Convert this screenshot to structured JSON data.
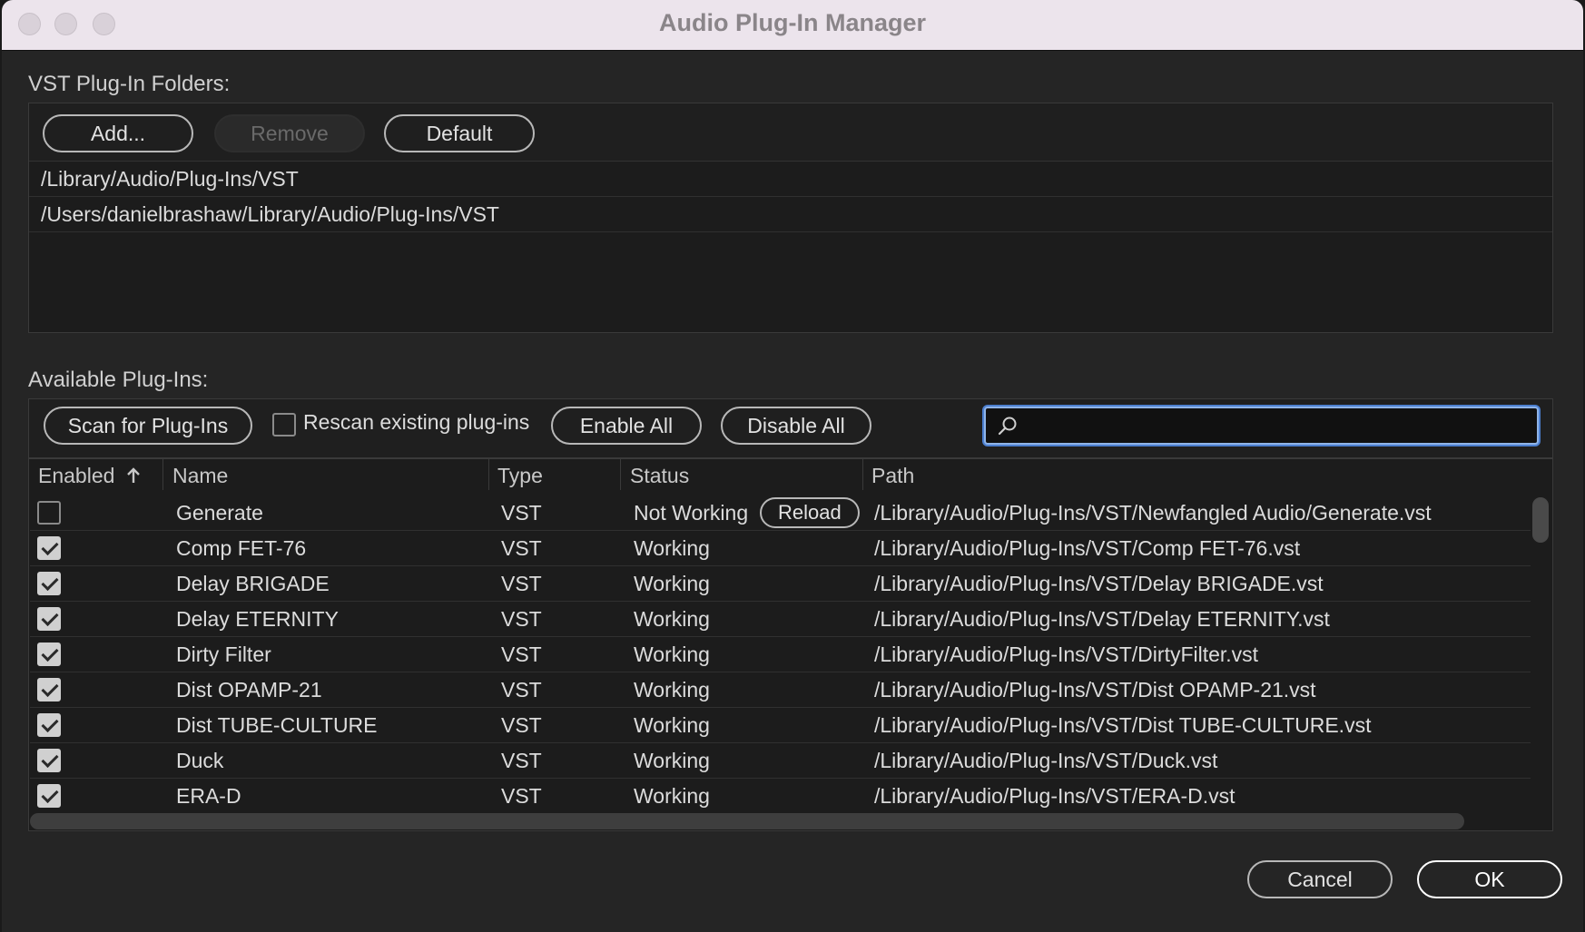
{
  "window": {
    "title": "Audio Plug-In Manager"
  },
  "vst_folders": {
    "label": "VST Plug-In Folders:",
    "add_label": "Add...",
    "remove_label": "Remove",
    "default_label": "Default",
    "paths": [
      "/Library/Audio/Plug-Ins/VST",
      "/Users/danielbrashaw/Library/Audio/Plug-Ins/VST"
    ]
  },
  "plugins": {
    "label": "Available Plug-Ins:",
    "scan_label": "Scan for Plug-Ins",
    "rescan_label": "Rescan existing plug-ins",
    "rescan_checked": false,
    "enable_all_label": "Enable All",
    "disable_all_label": "Disable All",
    "search_value": "",
    "columns": {
      "enabled": "Enabled",
      "name": "Name",
      "type": "Type",
      "status": "Status",
      "path": "Path"
    },
    "sort_icon": "arrow-up-icon",
    "reload_label": "Reload",
    "rows": [
      {
        "enabled": false,
        "name": "Generate",
        "type": "VST",
        "status": "Not Working",
        "has_reload": true,
        "path": "/Library/Audio/Plug-Ins/VST/Newfangled Audio/Generate.vst"
      },
      {
        "enabled": true,
        "name": "Comp FET-76",
        "type": "VST",
        "status": "Working",
        "has_reload": false,
        "path": "/Library/Audio/Plug-Ins/VST/Comp FET-76.vst"
      },
      {
        "enabled": true,
        "name": "Delay BRIGADE",
        "type": "VST",
        "status": "Working",
        "has_reload": false,
        "path": "/Library/Audio/Plug-Ins/VST/Delay BRIGADE.vst"
      },
      {
        "enabled": true,
        "name": "Delay ETERNITY",
        "type": "VST",
        "status": "Working",
        "has_reload": false,
        "path": "/Library/Audio/Plug-Ins/VST/Delay ETERNITY.vst"
      },
      {
        "enabled": true,
        "name": "Dirty Filter",
        "type": "VST",
        "status": "Working",
        "has_reload": false,
        "path": "/Library/Audio/Plug-Ins/VST/DirtyFilter.vst"
      },
      {
        "enabled": true,
        "name": "Dist OPAMP-21",
        "type": "VST",
        "status": "Working",
        "has_reload": false,
        "path": "/Library/Audio/Plug-Ins/VST/Dist OPAMP-21.vst"
      },
      {
        "enabled": true,
        "name": "Dist TUBE-CULTURE",
        "type": "VST",
        "status": "Working",
        "has_reload": false,
        "path": "/Library/Audio/Plug-Ins/VST/Dist TUBE-CULTURE.vst"
      },
      {
        "enabled": true,
        "name": "Duck",
        "type": "VST",
        "status": "Working",
        "has_reload": false,
        "path": "/Library/Audio/Plug-Ins/VST/Duck.vst"
      },
      {
        "enabled": true,
        "name": "ERA-D",
        "type": "VST",
        "status": "Working",
        "has_reload": false,
        "path": "/Library/Audio/Plug-Ins/VST/ERA-D.vst"
      }
    ]
  },
  "footer": {
    "cancel_label": "Cancel",
    "ok_label": "OK"
  },
  "colors": {
    "window_bg": "#252525",
    "titlebar_bg": "#ece4ec",
    "focus_ring": "#4c7fd0"
  }
}
